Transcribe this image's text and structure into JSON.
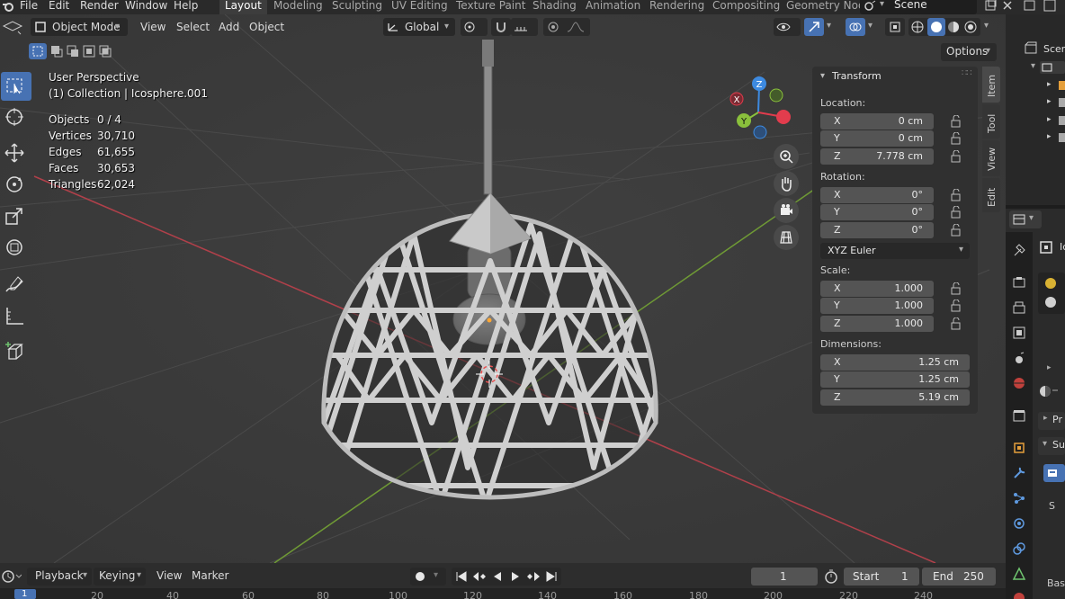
{
  "top_menu": {
    "file": "File",
    "edit": "Edit",
    "render": "Render",
    "window": "Window",
    "help": "Help"
  },
  "workspaces": [
    "Layout",
    "Modeling",
    "Sculpting",
    "UV Editing",
    "Texture Paint",
    "Shading",
    "Animation",
    "Rendering",
    "Compositing",
    "Geometry Nod"
  ],
  "scene_name": "Scene",
  "viewport_header": {
    "mode": "Object Mode",
    "view": "View",
    "select": "Select",
    "add": "Add",
    "object": "Object",
    "orientation": "Global",
    "options": "Options"
  },
  "overlay": {
    "perspective": "User Perspective",
    "collection": "(1) Collection | Icosphere.001",
    "stats": [
      {
        "label": "Objects",
        "value": "0 / 4"
      },
      {
        "label": "Vertices",
        "value": "30,710"
      },
      {
        "label": "Edges",
        "value": "61,655"
      },
      {
        "label": "Faces",
        "value": "30,653"
      },
      {
        "label": "Triangles",
        "value": "62,024"
      }
    ]
  },
  "gizmo": {
    "x": "X",
    "y": "Y",
    "z": "Z"
  },
  "n_panel": {
    "title": "Transform",
    "location_label": "Location:",
    "location": [
      {
        "axis": "X",
        "value": "0 cm"
      },
      {
        "axis": "Y",
        "value": "0 cm"
      },
      {
        "axis": "Z",
        "value": "7.778 cm"
      }
    ],
    "rotation_label": "Rotation:",
    "rotation": [
      {
        "axis": "X",
        "value": "0°"
      },
      {
        "axis": "Y",
        "value": "0°"
      },
      {
        "axis": "Z",
        "value": "0°"
      }
    ],
    "rotation_mode": "XYZ Euler",
    "scale_label": "Scale:",
    "scale": [
      {
        "axis": "X",
        "value": "1.000"
      },
      {
        "axis": "Y",
        "value": "1.000"
      },
      {
        "axis": "Z",
        "value": "1.000"
      }
    ],
    "dimensions_label": "Dimensions:",
    "dimensions": [
      {
        "axis": "X",
        "value": "1.25 cm"
      },
      {
        "axis": "Y",
        "value": "1.25 cm"
      },
      {
        "axis": "Z",
        "value": "5.19 cm"
      }
    ]
  },
  "side_tabs": [
    "Item",
    "Tool",
    "View",
    "Edit"
  ],
  "outliner": {
    "scene_label": "Scen"
  },
  "properties": {
    "object_name_partial": "Ic",
    "panel1_partial": "Pr",
    "panel2_partial": "Su",
    "base_partial": "Bas",
    "s_partial": "S"
  },
  "timeline": {
    "playback": "Playback",
    "keying": "Keying",
    "view": "View",
    "marker": "Marker",
    "current_frame": "1",
    "start_label": "Start",
    "start": "1",
    "end_label": "End",
    "end": "250",
    "ruler": [
      "1",
      "20",
      "40",
      "60",
      "80",
      "100",
      "120",
      "140",
      "160",
      "180",
      "200",
      "220",
      "240"
    ]
  },
  "colors": {
    "accent": "#4772b3",
    "x_axis": "#e23c4d",
    "y_axis": "#8ac03c",
    "z_axis": "#3d8ae0"
  }
}
